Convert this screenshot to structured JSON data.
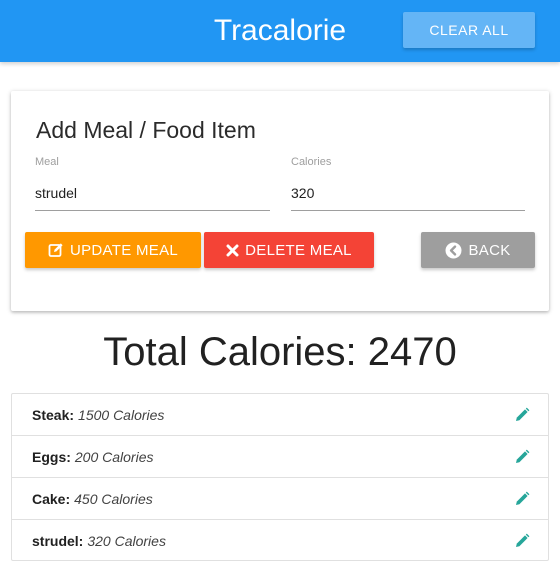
{
  "navbar": {
    "brand": "Tracalorie",
    "clear_all_label": "CLEAR ALL"
  },
  "form": {
    "title": "Add Meal / Food Item",
    "meal_label": "Meal",
    "meal_value": "strudel",
    "calories_label": "Calories",
    "calories_value": "320",
    "update_label": "UPDATE MEAL",
    "delete_label": "DELETE MEAL",
    "back_label": "BACK"
  },
  "total": {
    "label": "Total Calories:",
    "value": "2470"
  },
  "items": [
    {
      "name": "Steak:",
      "calories": "1500 Calories"
    },
    {
      "name": "Eggs:",
      "calories": "200 Calories"
    },
    {
      "name": "Cake:",
      "calories": "450 Calories"
    },
    {
      "name": "strudel:",
      "calories": "320 Calories"
    }
  ],
  "colors": {
    "navbar": "#2196f3",
    "clear_button": "#64b5f6",
    "update_button": "#ff9800",
    "delete_button": "#f44336",
    "back_button": "#9e9e9e",
    "edit_icon": "#26a69a"
  },
  "icons": {
    "update": "pencil-square-icon",
    "delete": "x-icon",
    "back": "chevron-circle-left-icon",
    "edit": "pencil-icon"
  }
}
